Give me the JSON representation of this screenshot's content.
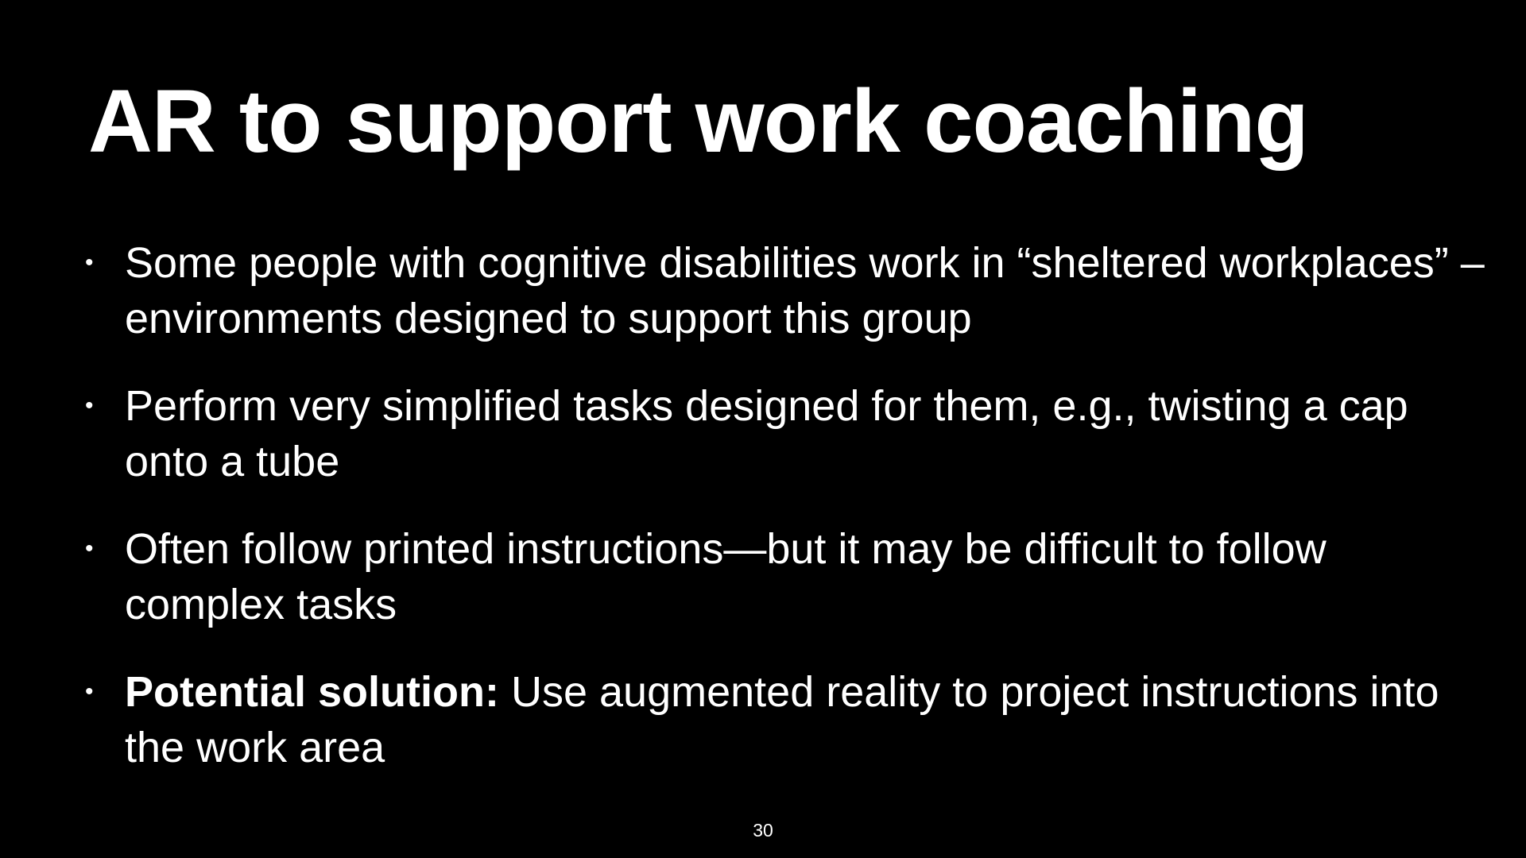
{
  "slide": {
    "title": "AR to support work coaching",
    "bullet_glyph": "•",
    "bullets": [
      {
        "text": "Some people with cognitive disabilities work in “sheltered workplaces” – environments designed to support this group"
      },
      {
        "text": "Perform very simplified tasks designed for them, e.g., twisting a cap onto a tube"
      },
      {
        "text": "Often follow printed instructions—but it may be difficult to follow complex tasks"
      },
      {
        "bold_lead": "Potential solution:",
        "text": " Use augmented reality to project instructions into the work area"
      }
    ],
    "page_number": "30"
  },
  "colors": {
    "background": "#000000",
    "text": "#ffffff"
  }
}
